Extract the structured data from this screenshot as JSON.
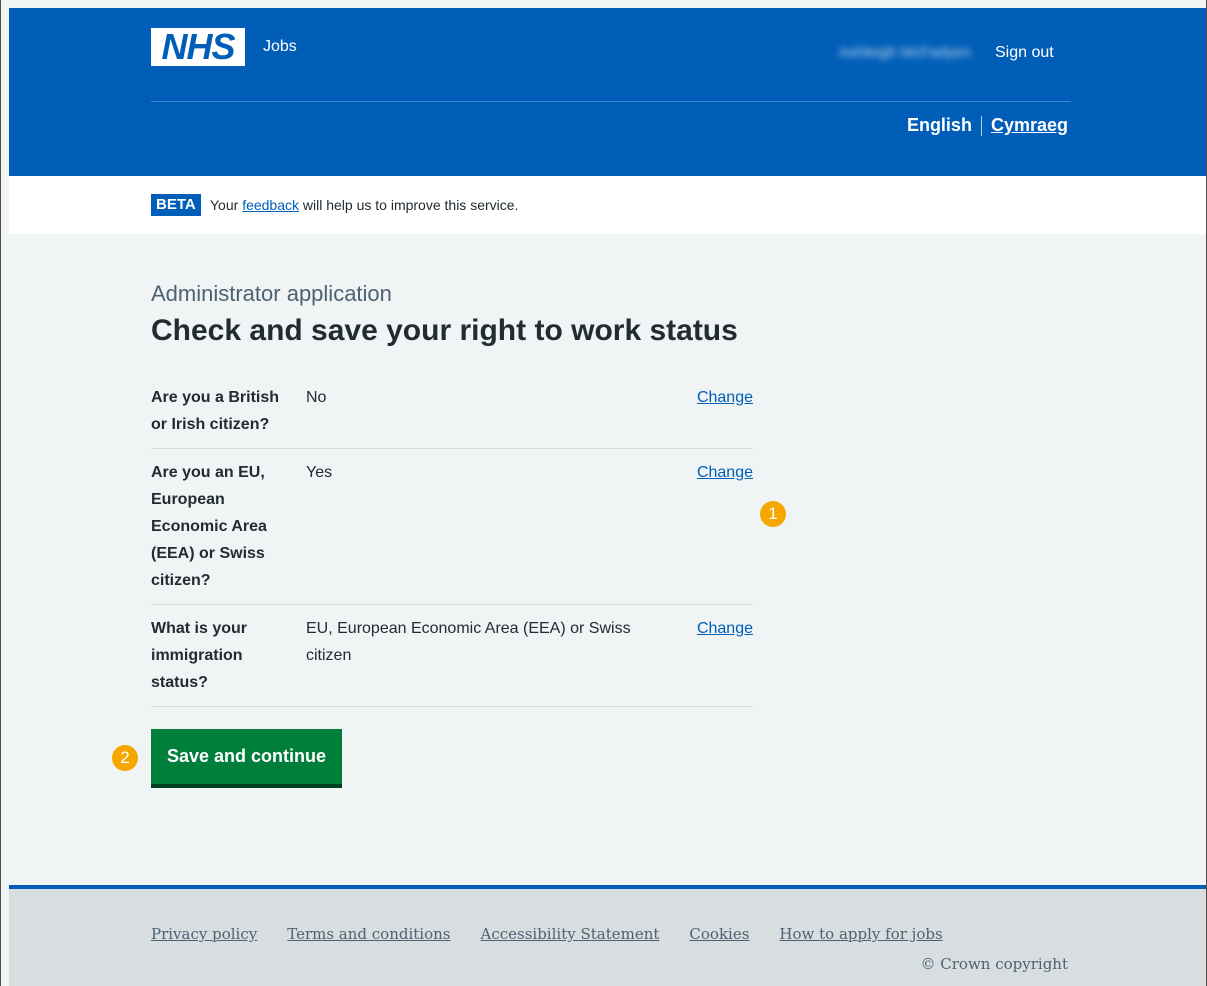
{
  "header": {
    "logo_text": "NHS",
    "service_name": "Jobs",
    "user_name": "Ashleigh McFadyen",
    "sign_out": "Sign out",
    "lang_english": "English",
    "lang_welsh": "Cymraeg"
  },
  "beta": {
    "tag": "BETA",
    "text_before": "Your",
    "link": "feedback",
    "text_after": "will help us to improve this service."
  },
  "main": {
    "caption": "Administrator application",
    "title": "Check and save your right to work status",
    "rows": [
      {
        "key": "Are you a British or Irish citizen?",
        "value": "No",
        "action": "Change"
      },
      {
        "key": "Are you an EU, European Economic Area (EEA) or Swiss citizen?",
        "value": "Yes",
        "action": "Change"
      },
      {
        "key": "What is your immigration status?",
        "value": "EU, European Economic Area (EEA) or Swiss citizen",
        "action": "Change"
      }
    ],
    "save_button": "Save and continue",
    "marker_1": "1",
    "marker_2": "2"
  },
  "footer": {
    "links": [
      "Privacy policy",
      "Terms and conditions",
      "Accessibility Statement",
      "Cookies",
      "How to apply for jobs"
    ],
    "copyright": "© Crown copyright"
  },
  "colors": {
    "nhs_blue": "#005eb8",
    "button_green": "#007f3b",
    "marker_orange": "#f5a700"
  }
}
